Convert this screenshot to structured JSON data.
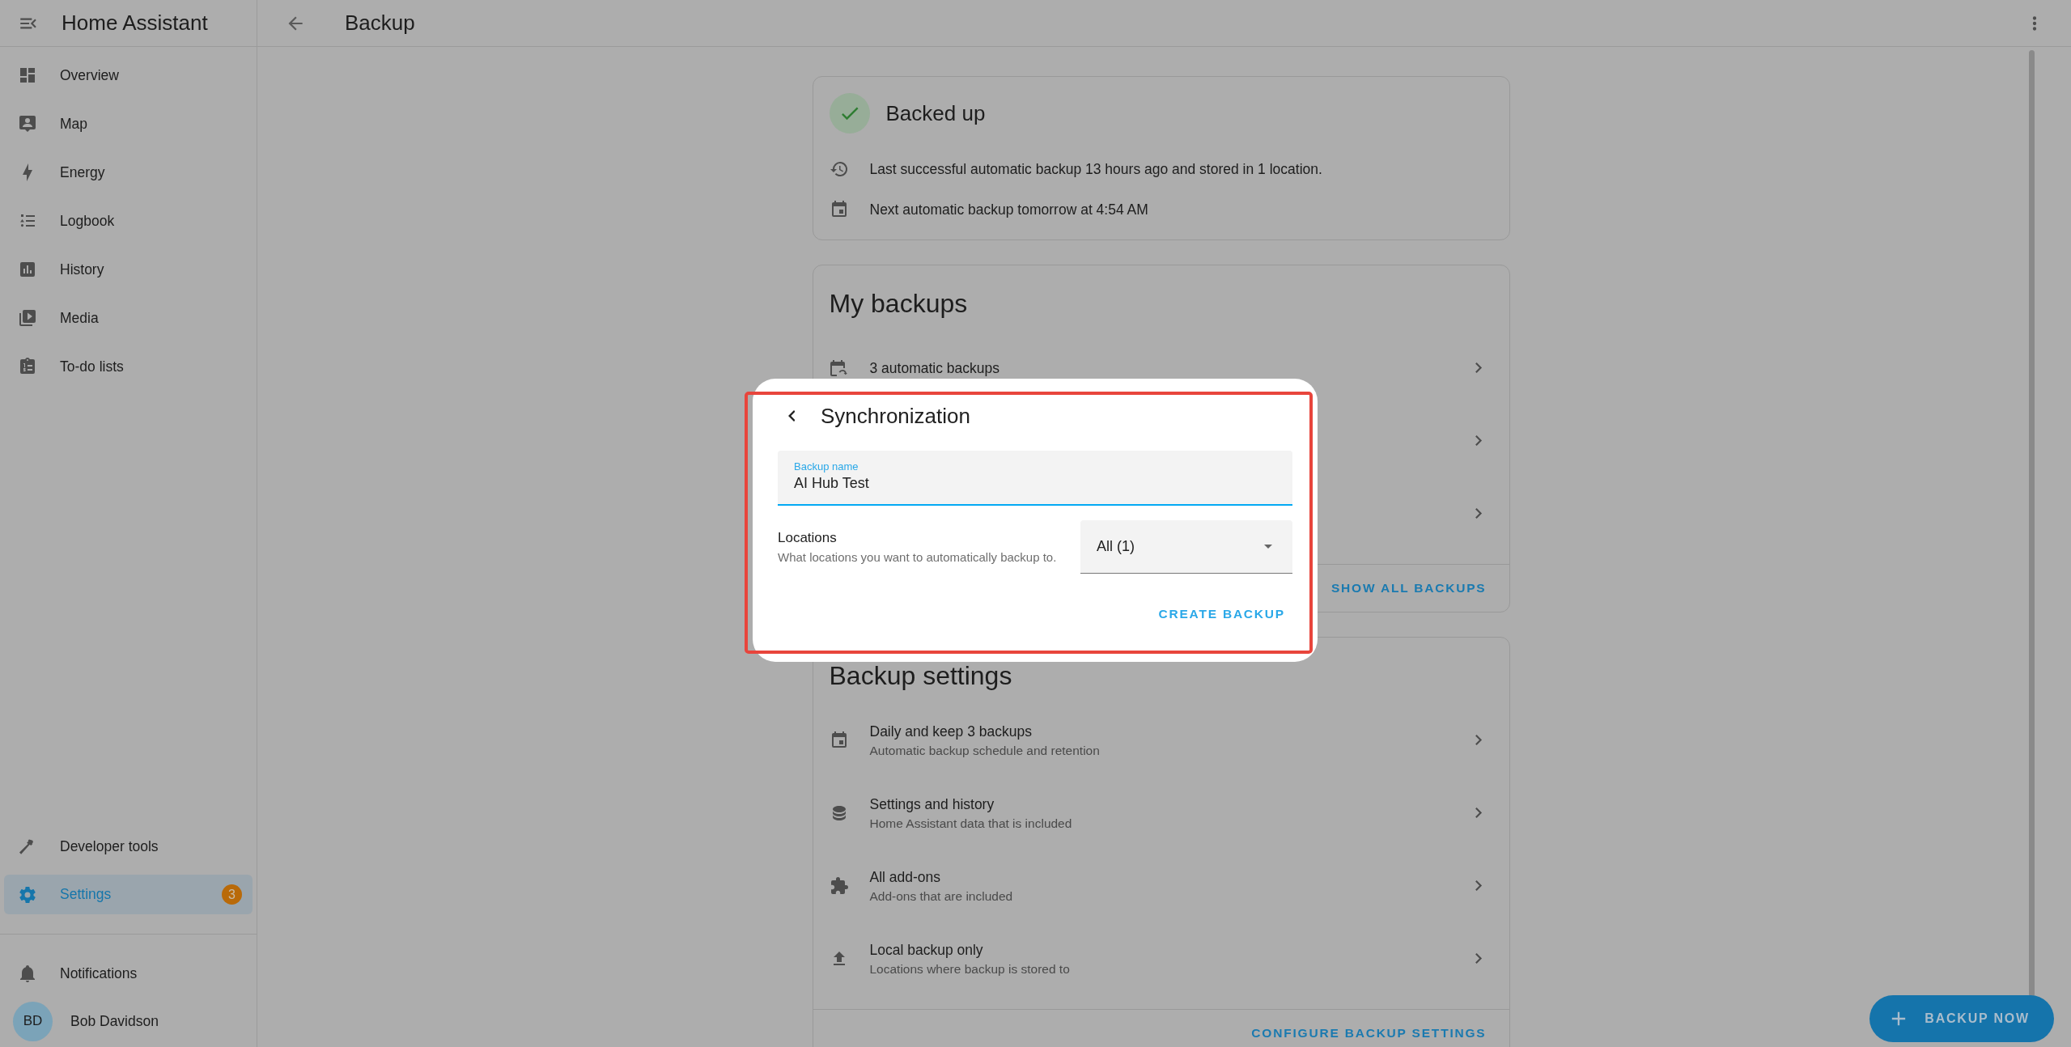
{
  "app": {
    "title": "Home Assistant"
  },
  "sidebar": {
    "items": [
      {
        "label": "Overview",
        "selected": false
      },
      {
        "label": "Map",
        "selected": false
      },
      {
        "label": "Energy",
        "selected": false
      },
      {
        "label": "Logbook",
        "selected": false
      },
      {
        "label": "History",
        "selected": false
      },
      {
        "label": "Media",
        "selected": false
      },
      {
        "label": "To-do lists",
        "selected": false
      }
    ],
    "bottom_items": [
      {
        "label": "Developer tools",
        "selected": false
      },
      {
        "label": "Settings",
        "selected": true,
        "badge": "3"
      }
    ],
    "notifications": {
      "label": "Notifications"
    },
    "user": {
      "initials": "BD",
      "name": "Bob Davidson"
    }
  },
  "page": {
    "title": "Backup"
  },
  "status_card": {
    "title": "Backed up",
    "lines": [
      {
        "text": "Last successful automatic backup 13 hours ago and stored in 1 location."
      },
      {
        "text": "Next automatic backup tomorrow at 4:54 AM"
      }
    ]
  },
  "my_backups": {
    "title": "My backups",
    "rows": [
      {
        "kind": "entry",
        "title": "3 automatic backups"
      },
      {
        "kind": "covered"
      },
      {
        "kind": "covered"
      }
    ],
    "action": "SHOW ALL BACKUPS"
  },
  "backup_settings": {
    "title": "Backup settings",
    "rows": [
      {
        "kind": "entry",
        "title": "Daily and keep 3 backups",
        "subtitle": "Automatic backup schedule and retention"
      },
      {
        "kind": "entry",
        "title": "Settings and history",
        "subtitle": "Home Assistant data that is included"
      },
      {
        "kind": "entry",
        "title": "All add-ons",
        "subtitle": "Add-ons that are included"
      },
      {
        "kind": "entry",
        "title": "Local backup only",
        "subtitle": "Locations where backup is stored to"
      }
    ],
    "action": "CONFIGURE BACKUP SETTINGS"
  },
  "dialog": {
    "title": "Synchronization",
    "name_field": {
      "label": "Backup name",
      "value": "AI Hub Test"
    },
    "locations": {
      "label": "Locations",
      "description": "What locations you want to automatically backup to.",
      "value": "All (1)"
    },
    "button": "CREATE BACKUP"
  },
  "fab": {
    "label": "BACKUP NOW"
  }
}
